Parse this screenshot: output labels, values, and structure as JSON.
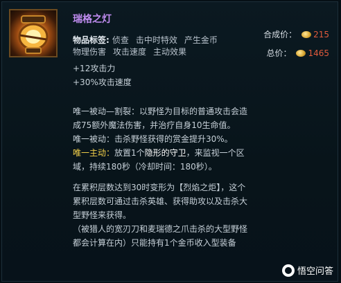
{
  "item": {
    "name": "瑞格之灯",
    "icon": "lantern-icon"
  },
  "tags": {
    "label": "物品标签:",
    "items": [
      "侦查",
      "击中时特效",
      "产生金币",
      "物理伤害",
      "攻击速度",
      "主动效果"
    ]
  },
  "price": {
    "combine_label": "合成价：",
    "combine_value": "215",
    "total_label": "总价：",
    "total_value": "1465",
    "coin_icon": "gold-coin-icon"
  },
  "stats": [
    "+12攻击力",
    "+30%攻击速度"
  ],
  "passive1": "唯一被动—割裂：以野怪为目标的普通攻击会造成75额外魔法伤害，并治疗自身10生命值。",
  "passive2": "唯一被动：击杀野怪获得的赏金提升30%。",
  "active": {
    "label": "唯一主动：",
    "pre": "放置1个",
    "highlight": "隐形的守卫",
    "post": "，来监视一个区域，持续180秒（冷却时间：180秒）。"
  },
  "transform": "在累积层数达到30时变形为【烈焰之炬】，这个累积层数可通过击杀英雄、获得助攻以及击杀大型野怪来获得。",
  "note": "（被猎人的宽刃刀和麦瑞德之爪击杀的大型野怪都会计算在内）只能持有1个金币收入型装备",
  "watermark": "悟空问答",
  "colors": {
    "title": "#c08cf0",
    "active_label": "#f2cf4a",
    "price_value": "#e05a3c"
  }
}
